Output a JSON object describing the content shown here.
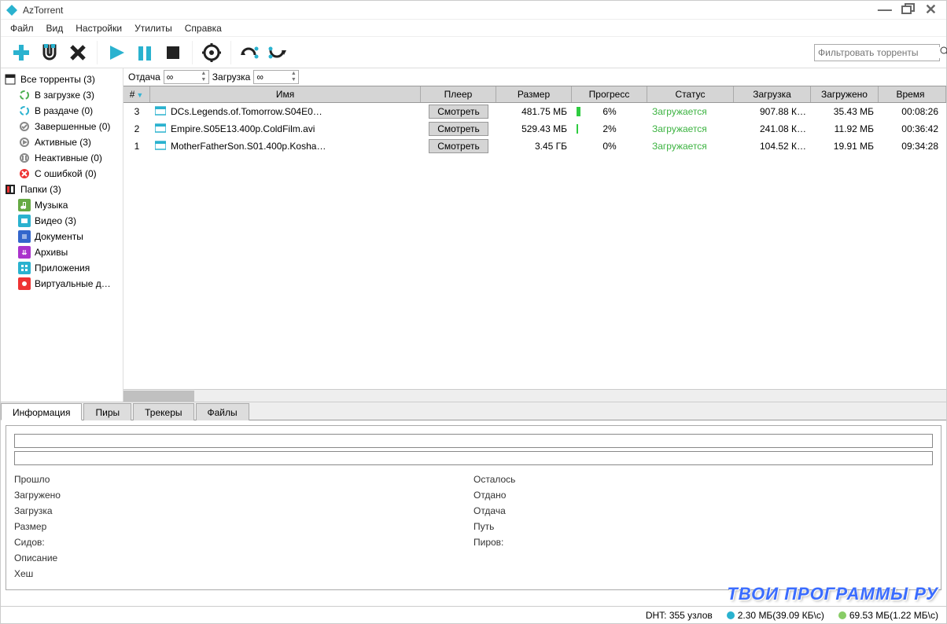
{
  "title": "AzTorrent",
  "menus": [
    "Файл",
    "Вид",
    "Настройки",
    "Утилиты",
    "Справка"
  ],
  "filter_placeholder": "Фильтровать торренты",
  "speedbar": {
    "upload_label": "Отдача",
    "upload_value": "∞",
    "download_label": "Загрузка",
    "download_value": "∞"
  },
  "sidebar": {
    "all": "Все торренты (3)",
    "downloading": "В загрузке (3)",
    "seeding": "В раздаче (0)",
    "completed": "Завершенные (0)",
    "active": "Активные (3)",
    "inactive": "Неактивные (0)",
    "error": "С ошибкой (0)",
    "folders": "Папки (3)",
    "music": "Музыка",
    "video": "Видео (3)",
    "docs": "Документы",
    "archives": "Архивы",
    "apps": "Приложения",
    "vd": "Виртуальные д…"
  },
  "columns": {
    "num": "#",
    "name": "Имя",
    "player": "Плеер",
    "size": "Размер",
    "progress": "Прогресс",
    "status": "Статус",
    "download": "Загрузка",
    "loaded": "Загружено",
    "time": "Время"
  },
  "player_button": "Смотреть",
  "rows": [
    {
      "num": "3",
      "name": "DCs.Legends.of.Tomorrow.S04E0…",
      "size": "481.75 МБ",
      "progress": "6%",
      "progress_pct": 6,
      "status": "Загружается",
      "download": "907.88 К…",
      "loaded": "35.43 МБ",
      "time": "00:08:26"
    },
    {
      "num": "2",
      "name": "Empire.S05E13.400p.ColdFilm.avi",
      "size": "529.43 МБ",
      "progress": "2%",
      "progress_pct": 2,
      "status": "Загружается",
      "download": "241.08 К…",
      "loaded": "11.92 МБ",
      "time": "00:36:42"
    },
    {
      "num": "1",
      "name": "MotherFatherSon.S01.400p.Kosha…",
      "size": "3.45 ГБ",
      "progress": "0%",
      "progress_pct": 0,
      "status": "Загружается",
      "download": "104.52 К…",
      "loaded": "19.91 МБ",
      "time": "09:34:28"
    }
  ],
  "tabs": [
    "Информация",
    "Пиры",
    "Трекеры",
    "Файлы"
  ],
  "info": {
    "left": [
      "Прошло",
      "Загружено",
      "Загрузка",
      "Размер",
      "Сидов:",
      "Описание",
      "Хеш"
    ],
    "right": [
      "Осталось",
      "Отдано",
      "Отдача",
      "Путь",
      "Пиров:"
    ]
  },
  "status": {
    "dht": "DHT: 355 узлов",
    "down": "2.30 МБ(39.09 КБ\\с)",
    "up": "69.53 МБ(1.22 МБ\\с)"
  },
  "watermark": "ТВОИ ПРОГРАММЫ РУ"
}
